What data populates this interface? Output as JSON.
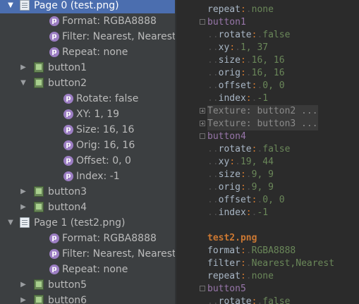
{
  "tree": {
    "items": [
      {
        "label": "Page 0 (test.png)",
        "indent": 0,
        "arrow": "down",
        "icon": "file",
        "selected": true
      },
      {
        "label": "Format: RGBA8888",
        "indent": 2,
        "arrow": "",
        "icon": "prop"
      },
      {
        "label": "Filter: Nearest, Nearest",
        "indent": 2,
        "arrow": "",
        "icon": "prop"
      },
      {
        "label": "Repeat: none",
        "indent": 2,
        "arrow": "",
        "icon": "prop"
      },
      {
        "label": "button1",
        "indent": 1,
        "arrow": "right",
        "icon": "region"
      },
      {
        "label": "button2",
        "indent": 1,
        "arrow": "down",
        "icon": "region"
      },
      {
        "label": "Rotate: false",
        "indent": 3,
        "arrow": "",
        "icon": "prop"
      },
      {
        "label": "XY: 1, 19",
        "indent": 3,
        "arrow": "",
        "icon": "prop"
      },
      {
        "label": "Size: 16, 16",
        "indent": 3,
        "arrow": "",
        "icon": "prop"
      },
      {
        "label": "Orig: 16, 16",
        "indent": 3,
        "arrow": "",
        "icon": "prop"
      },
      {
        "label": "Offset: 0, 0",
        "indent": 3,
        "arrow": "",
        "icon": "prop"
      },
      {
        "label": "Index: -1",
        "indent": 3,
        "arrow": "",
        "icon": "prop"
      },
      {
        "label": "button3",
        "indent": 1,
        "arrow": "right",
        "icon": "region"
      },
      {
        "label": "button4",
        "indent": 1,
        "arrow": "right",
        "icon": "region"
      },
      {
        "label": "Page 1 (test2.png)",
        "indent": 0,
        "arrow": "down",
        "icon": "file"
      },
      {
        "label": "Format: RGBA8888",
        "indent": 2,
        "arrow": "",
        "icon": "prop"
      },
      {
        "label": "Filter: Nearest, Nearest",
        "indent": 2,
        "arrow": "",
        "icon": "prop"
      },
      {
        "label": "Repeat: none",
        "indent": 2,
        "arrow": "",
        "icon": "prop"
      },
      {
        "label": "button5",
        "indent": 1,
        "arrow": "right",
        "icon": "region"
      },
      {
        "label": "button6",
        "indent": 1,
        "arrow": "right",
        "icon": "region"
      }
    ],
    "prop_icon_letter": "p"
  },
  "editor": {
    "lines": [
      {
        "type": "kv",
        "dots": "",
        "key": "repeat",
        "value": "none"
      },
      {
        "type": "section",
        "fold": "box",
        "text": "button1"
      },
      {
        "type": "kv",
        "dots": "..",
        "key": "rotate",
        "value": "false"
      },
      {
        "type": "kv",
        "dots": "..",
        "key": "xy",
        "value": "1, 37"
      },
      {
        "type": "kv",
        "dots": "..",
        "key": "size",
        "value": "16, 16"
      },
      {
        "type": "kv",
        "dots": "..",
        "key": "orig",
        "value": "16, 16"
      },
      {
        "type": "kv",
        "dots": "..",
        "key": "offset",
        "value": "0, 0"
      },
      {
        "type": "kv",
        "dots": "..",
        "key": "index",
        "value": "-1"
      },
      {
        "type": "folded",
        "text": "Texture: button2 ..."
      },
      {
        "type": "folded",
        "text": "Texture: button3 ..."
      },
      {
        "type": "section",
        "fold": "box",
        "text": "button4"
      },
      {
        "type": "kv",
        "dots": "..",
        "key": "rotate",
        "value": "false"
      },
      {
        "type": "kv",
        "dots": "..",
        "key": "xy",
        "value": "19, 44"
      },
      {
        "type": "kv",
        "dots": "..",
        "key": "size",
        "value": "9, 9"
      },
      {
        "type": "kv",
        "dots": "..",
        "key": "orig",
        "value": "9, 9"
      },
      {
        "type": "kv",
        "dots": "..",
        "key": "offset",
        "value": "0, 0"
      },
      {
        "type": "kv",
        "dots": "..",
        "key": "index",
        "value": "-1"
      },
      {
        "type": "blank"
      },
      {
        "type": "page",
        "text": "test2.png"
      },
      {
        "type": "kv",
        "dots": "",
        "key": "format",
        "value": "RGBA8888"
      },
      {
        "type": "kv",
        "dots": "",
        "key": "filter",
        "value": "Nearest,Nearest"
      },
      {
        "type": "kv",
        "dots": "",
        "key": "repeat",
        "value": "none"
      },
      {
        "type": "section",
        "fold": "box",
        "text": "button5"
      },
      {
        "type": "kv",
        "dots": "..",
        "key": "rotate",
        "value": "false"
      }
    ]
  }
}
